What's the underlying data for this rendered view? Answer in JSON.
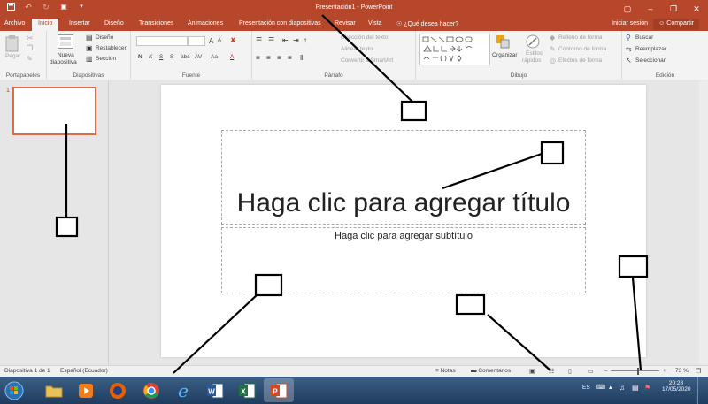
{
  "title_bar": {
    "document_title": "Presentación1 - PowerPoint",
    "qat_icons": [
      "save-icon",
      "undo-icon",
      "redo-icon",
      "start-from-beginning-icon",
      "customize-qat-icon"
    ]
  },
  "tabs": [
    {
      "label": "Archivo"
    },
    {
      "label": "Inicio"
    },
    {
      "label": "Insertar"
    },
    {
      "label": "Diseño"
    },
    {
      "label": "Transiciones"
    },
    {
      "label": "Animaciones"
    },
    {
      "label": "Presentación con diapositivas"
    },
    {
      "label": "Revisar"
    },
    {
      "label": "Vista"
    },
    {
      "label": "¿Qué desea hacer?"
    }
  ],
  "account": {
    "sign_in": "Iniciar sesión",
    "share": "Compartir"
  },
  "ribbon": {
    "portapapeles": {
      "label": "Portapapeles",
      "paste": "Pegar"
    },
    "diapositivas": {
      "label": "Diapositivas",
      "new_slide_1": "Nueva",
      "new_slide_2": "diapositiva",
      "layout": "Diseño",
      "reset": "Restablecer",
      "section": "Sección"
    },
    "fuente": {
      "label": "Fuente",
      "bold": "N",
      "italic": "K",
      "underline": "S",
      "shadow": "S",
      "strike": "abc",
      "spacing": "AV",
      "case": "Aa",
      "grow": "A",
      "shrink": "A"
    },
    "parrafo": {
      "label": "Párrafo",
      "text_direction": "Dirección del texto",
      "align_text": "Alinear texto",
      "smartart": "Convertir a SmartArt"
    },
    "dibujo": {
      "label": "Dibujo",
      "arrange": "Organizar",
      "quick_styles_1": "Estilos",
      "quick_styles_2": "rápidos",
      "fill": "Relleno de forma",
      "outline": "Contorno de forma",
      "effects": "Efectos de forma"
    },
    "edicion": {
      "label": "Edición",
      "find": "Buscar",
      "replace": "Reemplazar",
      "select": "Seleccionar"
    }
  },
  "thumbnails": {
    "slide_number": "1"
  },
  "slide": {
    "title_placeholder": "Haga clic para agregar título",
    "subtitle_placeholder": "Haga clic para agregar subtítulo"
  },
  "status_bar": {
    "slide_info": "Diapositiva 1 de 1",
    "language": "Español (Ecuador)",
    "notes": "Notas",
    "comments": "Comentarios",
    "zoom": "73 %",
    "zoom_level": 0.73
  },
  "taskbar": {
    "apps": [
      "start",
      "explorer",
      "media-player",
      "firefox",
      "chrome",
      "internet-explorer",
      "word",
      "excel",
      "powerpoint"
    ],
    "language": "ES",
    "time": "20:28",
    "date": "17/05/2020"
  },
  "colors": {
    "accent": "#b7472a",
    "ribbon_bg": "#f3f3f3",
    "workspace_bg": "#e6e6e6",
    "thumb_border": "#e06c47"
  }
}
